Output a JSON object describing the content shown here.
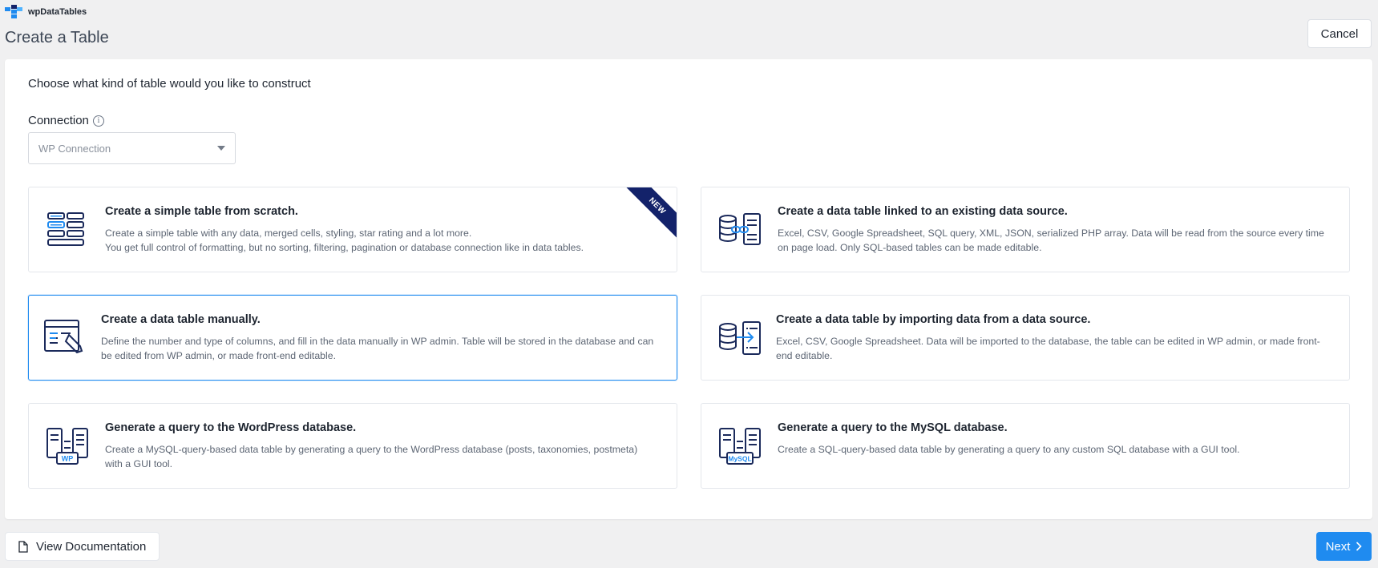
{
  "header": {
    "brand_name": "wpDataTables",
    "page_title": "Create a Table",
    "cancel_label": "Cancel"
  },
  "panel": {
    "intro": "Choose what kind of table would you like to construct",
    "connection_label": "Connection",
    "connection_value": "WP Connection"
  },
  "cards": [
    {
      "title": "Create a simple table from scratch.",
      "desc1": "Create a simple table with any data, merged cells, styling, star rating and a lot more.",
      "desc2": "You get full control of formatting, but no sorting, filtering, pagination or database connection like in data tables.",
      "badge": "NEW",
      "icon": "simple-table-icon"
    },
    {
      "title": "Create a data table linked to an existing data source.",
      "desc1": "Excel, CSV, Google Spreadsheet, SQL query, XML, JSON, serialized PHP array. Data will be read from the source every time on page load. Only SQL-based tables can be made editable.",
      "icon": "linked-data-source-icon"
    },
    {
      "title": "Create a data table manually.",
      "desc1": "Define the number and type of columns, and fill in the data manually in WP admin. Table will be stored in the database and can be edited from WP admin, or made front-end editable.",
      "icon": "manual-table-icon"
    },
    {
      "title": "Create a data table by importing data from a data source.",
      "desc1": "Excel, CSV, Google Spreadsheet. Data will be imported to the database, the table can be edited in WP admin, or made front-end editable.",
      "icon": "import-data-icon"
    },
    {
      "title": "Generate a query to the WordPress database.",
      "desc1": "Create a MySQL-query-based data table by generating a query to the WordPress database (posts, taxonomies, postmeta) with a GUI tool.",
      "icon": "wordpress-query-icon",
      "icon_label": "WP"
    },
    {
      "title": "Generate a query to the MySQL database.",
      "desc1": "Create a SQL-query-based data table by generating a query to any custom SQL database with a GUI tool.",
      "icon": "mysql-query-icon",
      "icon_label": "MySQL"
    }
  ],
  "footer": {
    "documentation_label": "View Documentation",
    "next_label": "Next"
  },
  "colors": {
    "accent": "#1f8bf0",
    "ribbon": "#13226a",
    "icon_dark": "#1b2a5b"
  }
}
